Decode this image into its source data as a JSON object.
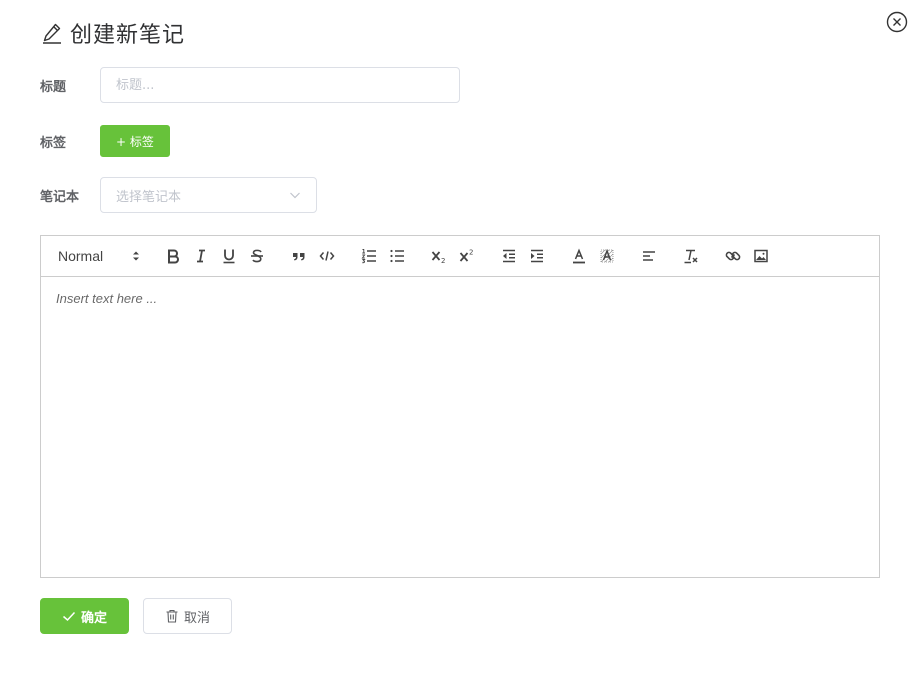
{
  "dialog": {
    "title": "创建新笔记",
    "title_icon": "pencil-icon",
    "close_icon": "close-circle-icon"
  },
  "form": {
    "title_label": "标题",
    "title_placeholder": "标题...",
    "title_value": "",
    "tags_label": "标签",
    "add_tag_label": "+ 标签",
    "notebook_label": "笔记本",
    "notebook_placeholder": "选择笔记本"
  },
  "editor": {
    "header_select": "Normal",
    "placeholder": "Insert text here ...",
    "toolbar_icons": [
      "bold-icon",
      "italic-icon",
      "underline-icon",
      "strike-icon",
      "blockquote-icon",
      "code-block-icon",
      "ordered-list-icon",
      "bullet-list-icon",
      "subscript-icon",
      "superscript-icon",
      "outdent-icon",
      "indent-icon",
      "text-color-icon",
      "background-color-icon",
      "align-icon",
      "clear-format-icon",
      "link-icon",
      "image-icon"
    ]
  },
  "actions": {
    "confirm_label": "确定",
    "cancel_label": "取消"
  },
  "colors": {
    "primary_green": "#67c23a",
    "border": "#dcdfe6",
    "placeholder": "#c0c4cc"
  }
}
